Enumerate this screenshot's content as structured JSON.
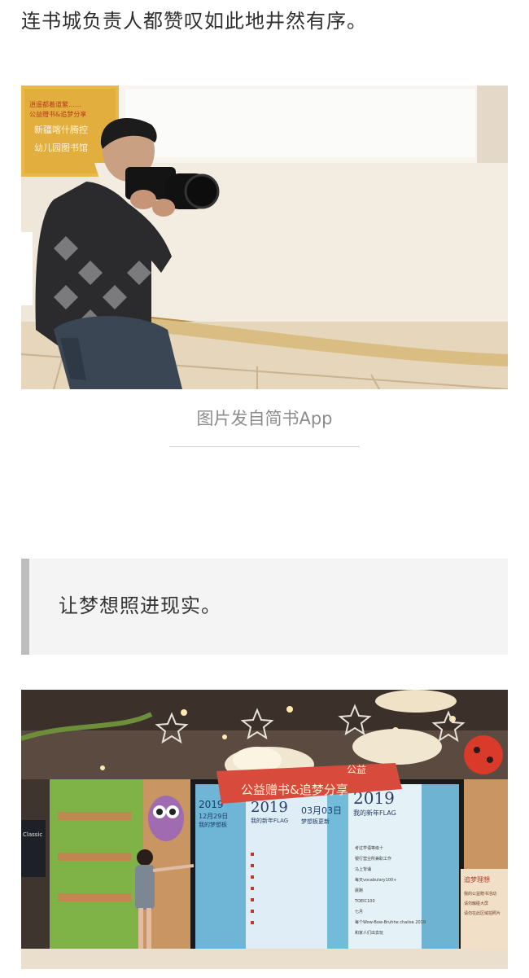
{
  "article": {
    "paragraph_1": "连书城负责人都赞叹如此地井然有序。",
    "caption_1": "图片发自简书App",
    "quote_1": "让梦想照进现实。"
  },
  "photo_1": {
    "sign_lines": [
      "逍遥都着道繁……",
      "公益赠书&追梦分享",
      "新疆喀什腾控",
      "幼儿园图书馆"
    ]
  },
  "photo_2": {
    "banner_title": "公益赠书&追梦分享",
    "banner_top": "公益",
    "screen_col1_year": "2019",
    "screen_col1_date": "12月29日",
    "screen_col1_sub": "我的梦想板",
    "screen_col2_year": "2019",
    "screen_col2_sub": "我的新年FLAG",
    "screen_col3_date": "03月03日",
    "screen_col3_sub": "梦想板更新",
    "screen_col4_year": "2019",
    "screen_col4_sub": "我的新年FLAG",
    "list_items": [
      "考过学语等级十",
      "银行营业所兼职工作",
      "马上背诵",
      "每天vocabulary100+",
      "晨跑",
      "TOEIC100",
      "七月",
      "每个Wow-Bow-Bruhhe chaiise 2019",
      "和家人们出去玩"
    ],
    "side_sign_title": "追梦理想",
    "side_sign_lines": [
      "我的公益赠书活动",
      "请勿触碰大屏",
      "请勿在此区域拍照片"
    ],
    "store_sign": "Classic"
  }
}
